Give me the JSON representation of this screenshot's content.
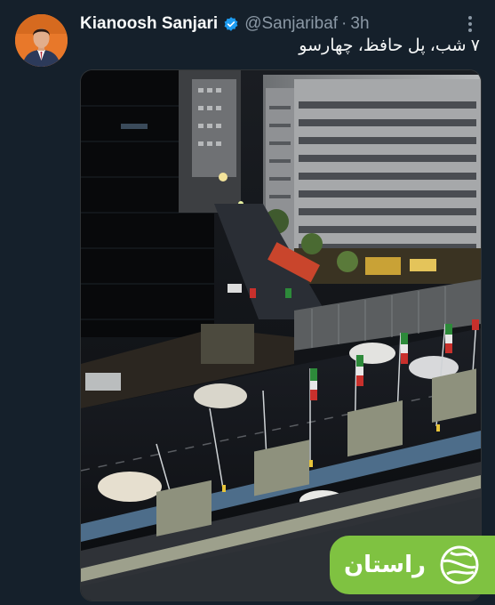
{
  "tweet": {
    "author_name": "Kianoosh Sanjari",
    "handle": "@Sanjaribaf",
    "separator": "·",
    "time": "3h",
    "text": "۷ شب، پل حافظ، چهارسو"
  },
  "overlay": {
    "brand_label": "راستان",
    "brand_color": "#7fc241"
  },
  "icons": {
    "verified": "verified-badge-icon",
    "more": "more-vertical-icon",
    "brand": "globe-logo-icon"
  }
}
